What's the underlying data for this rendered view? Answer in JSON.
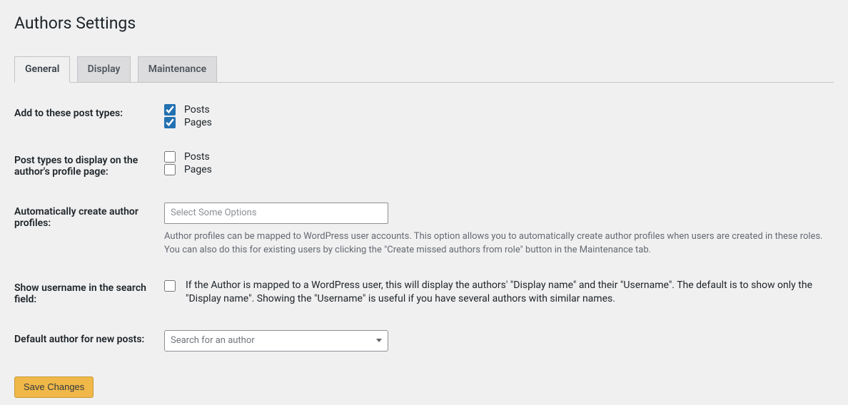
{
  "page": {
    "title": "Authors Settings"
  },
  "tabs": {
    "general": "General",
    "display": "Display",
    "maintenance": "Maintenance"
  },
  "fields": {
    "add_post_types": {
      "label": "Add to these post types:",
      "options": {
        "posts": "Posts",
        "pages": "Pages"
      }
    },
    "profile_post_types": {
      "label": "Post types to display on the author's profile page:",
      "options": {
        "posts": "Posts",
        "pages": "Pages"
      }
    },
    "auto_create": {
      "label": "Automatically create author profiles:",
      "placeholder": "Select Some Options",
      "description": "Author profiles can be mapped to WordPress user accounts. This option allows you to automatically create author profiles when users are created in these roles. You can also do this for existing users by clicking the \"Create missed authors from role\" button in the Maintenance tab."
    },
    "show_username": {
      "label": "Show username in the search field:",
      "description": "If the Author is mapped to a WordPress user, this will display the authors' \"Display name\" and their \"Username\". The default is to show only the \"Display name\". Showing the \"Username\" is useful if you have several authors with similar names."
    },
    "default_author": {
      "label": "Default author for new posts:",
      "placeholder": "Search for an author"
    }
  },
  "buttons": {
    "save": "Save Changes"
  }
}
